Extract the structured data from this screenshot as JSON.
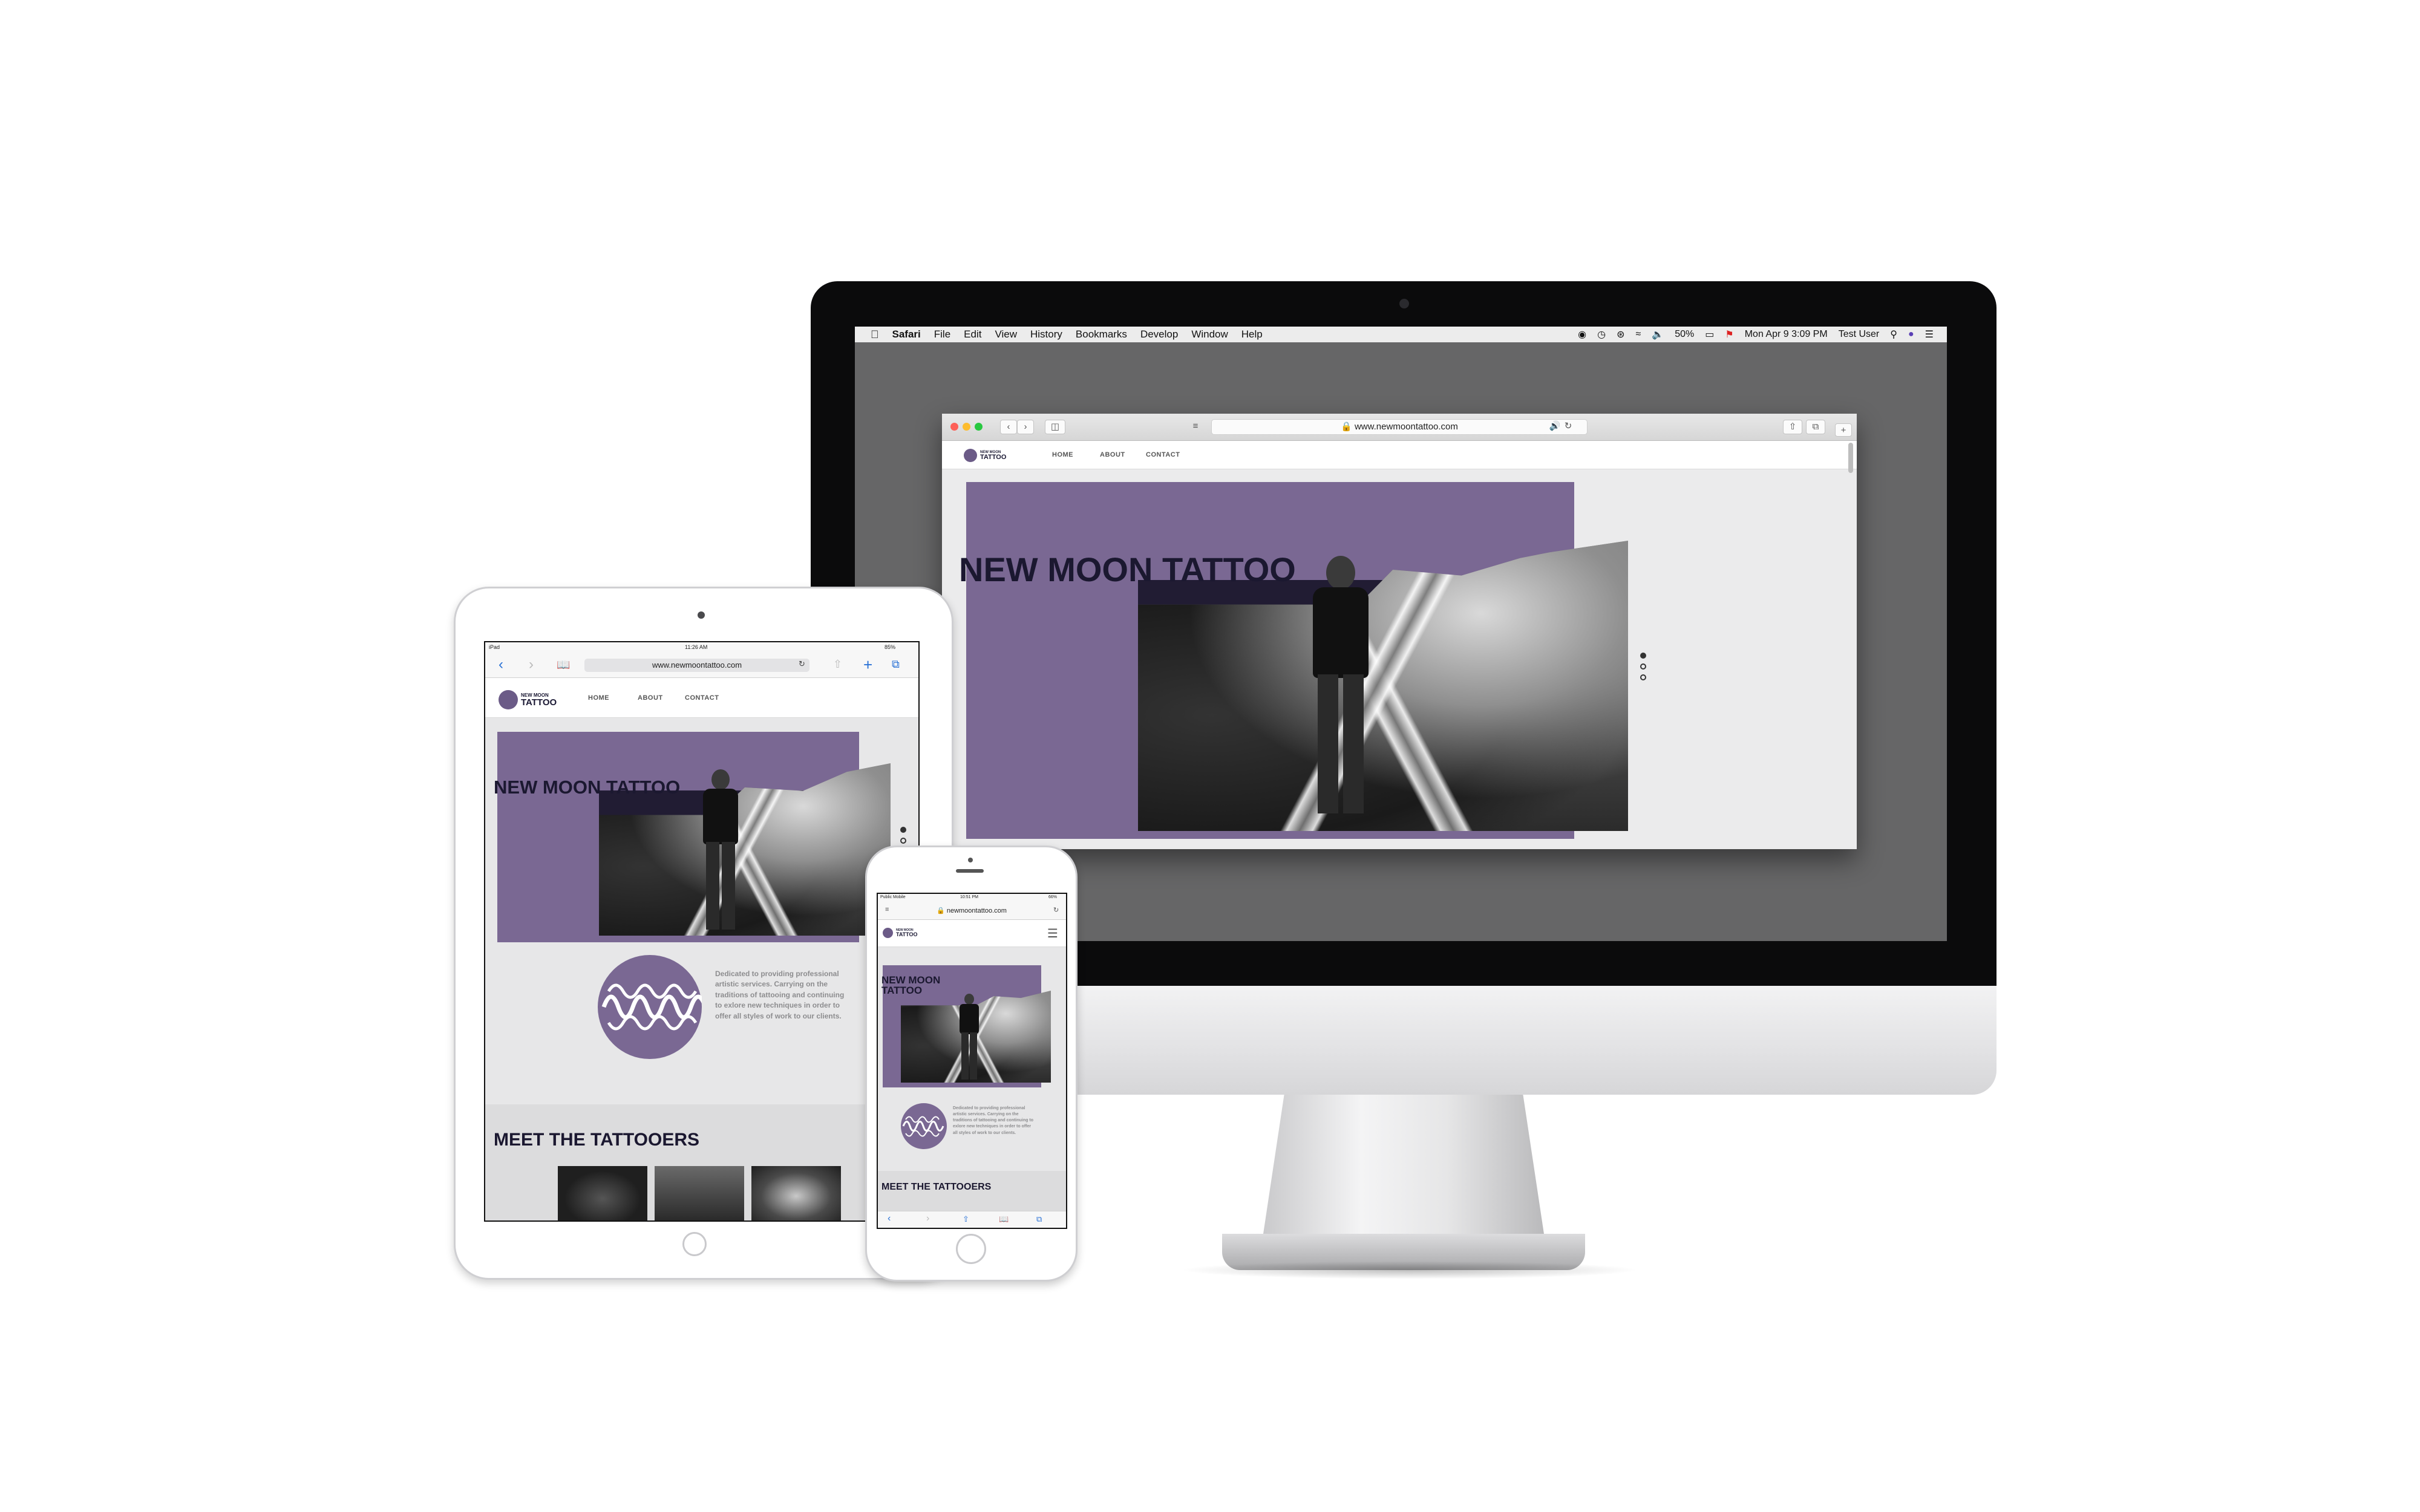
{
  "mac_menubar": {
    "app": "Safari",
    "menus": [
      "File",
      "Edit",
      "View",
      "History",
      "Bookmarks",
      "Develop",
      "Window",
      "Help"
    ],
    "battery": "50%",
    "clock": "Mon Apr 9  3:09 PM",
    "user": "Test User"
  },
  "desktop_browser": {
    "url": "www.newmoontattoo.com",
    "nav": [
      "HOME",
      "ABOUT",
      "CONTACT"
    ],
    "logo_small": "NEW MOON",
    "logo_big": "TATTOO",
    "hero_title": "NEW MOON TATTOO"
  },
  "ipad": {
    "status_left": "iPad",
    "status_time": "11:26 AM",
    "status_battery": "85%",
    "url": "www.newmoontattoo.com",
    "nav": [
      "HOME",
      "ABOUT",
      "CONTACT"
    ],
    "logo_small": "NEW MOON",
    "logo_big": "TATTOO",
    "hero_title": "NEW MOON TATTOO",
    "about": "Dedicated to providing professional artistic services. Carrying on the traditions of tattooing and continuing to exlore new techniques in order to offer all styles of work to our clients.",
    "section_title": "MEET THE TATTOOERS"
  },
  "iphone": {
    "status_left": "Public Mobile",
    "status_time": "10:51 PM",
    "status_battery": "66%",
    "url": "newmoontattoo.com",
    "logo_small": "NEW MOON",
    "logo_big": "TATTOO",
    "hero_title": "NEW MOON TATTOO",
    "about": "Dedicated to providing professional artistic services. Carrying on the traditions of tattooing and continuing to exlore new techniques in order to offer all styles of work to our clients.",
    "section_title": "MEET THE TATTOOERS"
  },
  "colors": {
    "brand_purple": "#7a6893",
    "brand_dark": "#211c33",
    "page_bg": "#e7e7e8"
  }
}
